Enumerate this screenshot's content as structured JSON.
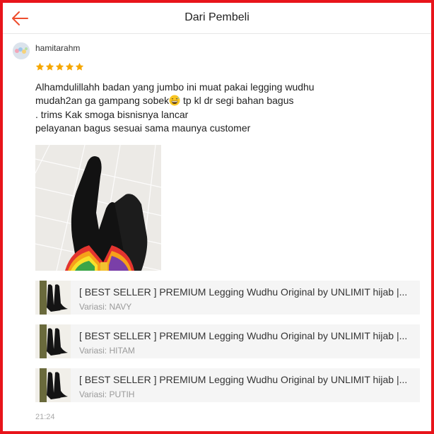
{
  "header": {
    "title": "Dari Pembeli",
    "back_icon": "arrow-left-icon"
  },
  "accent_color": "#ee4d2d",
  "frame_color": "#e8141b",
  "review": {
    "username": "hamitarahm",
    "rating": 5,
    "max_rating": 5,
    "text_lines": [
      "Alhamdulillahh badan yang jumbo ini muat pakai legging wudhu",
      "mudah2an ga gampang sobek",
      " tp kl dr segi bahan bagus",
      ". trims Kak smoga bisnisnya lancar",
      "pelayanan bagus sesuai sama maunya customer"
    ],
    "emoji": "grinning-sweat-emoji",
    "time": "21:24"
  },
  "products": [
    {
      "name": "[ BEST SELLER ] PREMIUM Legging Wudhu Original by UNLIMIT hijab |...",
      "variant": "Variasi: NAVY"
    },
    {
      "name": "[ BEST SELLER ] PREMIUM Legging Wudhu Original by UNLIMIT hijab |...",
      "variant": "Variasi: HITAM"
    },
    {
      "name": "[ BEST SELLER ] PREMIUM Legging Wudhu Original by UNLIMIT hijab |...",
      "variant": "Variasi: PUTIH"
    }
  ]
}
